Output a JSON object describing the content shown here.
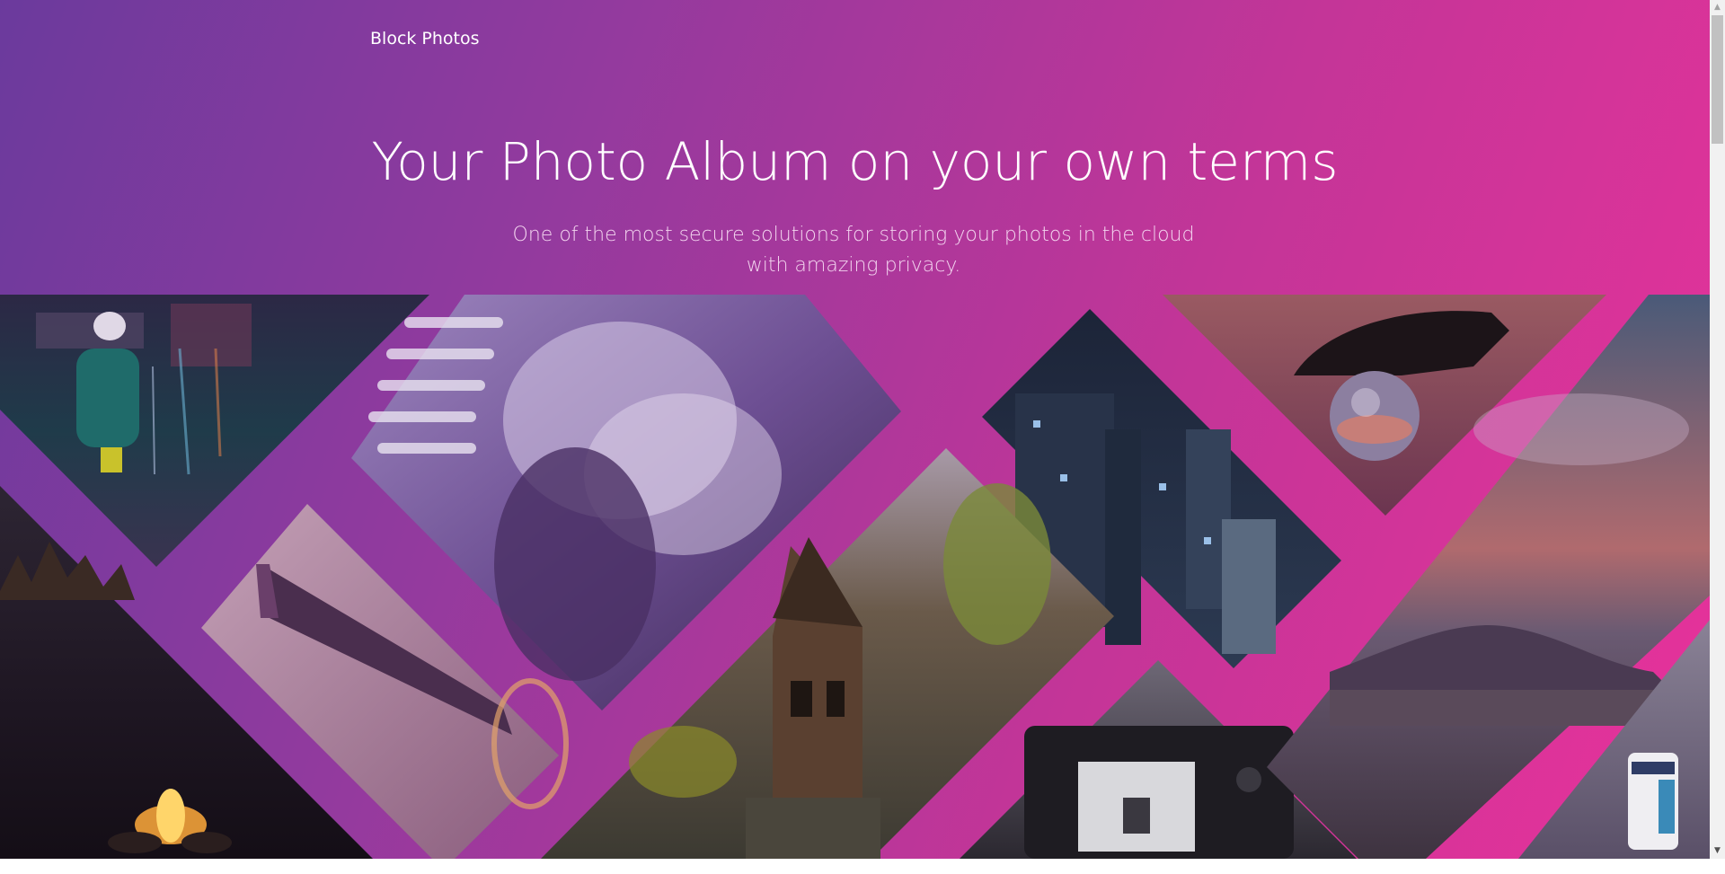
{
  "brand": {
    "name": "Block Photos"
  },
  "hero": {
    "headline": "Your Photo Album on your own terms",
    "subtitle": "One of the most secure solutions for storing your photos in the cloud with amazing privacy."
  },
  "collage": {
    "photos": [
      {
        "name": "photo-rider-in-rain-city",
        "subject": "rider in rain city street"
      },
      {
        "name": "photo-smoke-portrait",
        "subject": "portrait with smoke"
      },
      {
        "name": "photo-city-skyscrapers",
        "subject": "city skyscrapers at night"
      },
      {
        "name": "photo-hand-crystal-ball",
        "subject": "hand holding crystal ball"
      },
      {
        "name": "photo-campfire-forest",
        "subject": "campfire in forest"
      },
      {
        "name": "photo-airplane-wing",
        "subject": "airplane wing"
      },
      {
        "name": "photo-wooden-cabin",
        "subject": "wooden cabin"
      },
      {
        "name": "photo-camera-back",
        "subject": "camera back screen"
      },
      {
        "name": "photo-mountain-sunset",
        "subject": "mountain sunset"
      },
      {
        "name": "photo-film-roll",
        "subject": "film roll"
      }
    ]
  },
  "scrollbar": {
    "up_icon": "arrow-up-icon",
    "down_icon": "arrow-down-icon"
  },
  "colors": {
    "gradient_start": "#6b3a9d",
    "gradient_mid": "#c33598",
    "gradient_end": "#e8329a",
    "text": "#ffffff"
  }
}
